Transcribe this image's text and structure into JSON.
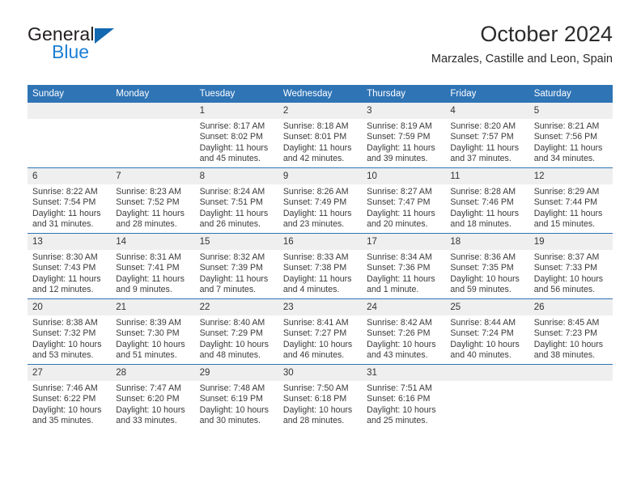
{
  "brand": {
    "name_top": "General",
    "name_bottom": "Blue",
    "triangle_color": "#1368b0",
    "blue_color": "#1d7fd4"
  },
  "header": {
    "title": "October 2024",
    "subtitle": "Marzales, Castille and Leon, Spain"
  },
  "theme": {
    "header_bg": "#2f74b5",
    "daynum_bg": "#efefef",
    "row_border": "#2f74b5",
    "text": "#3a3a3a"
  },
  "weekdays": [
    "Sunday",
    "Monday",
    "Tuesday",
    "Wednesday",
    "Thursday",
    "Friday",
    "Saturday"
  ],
  "labels": {
    "sunrise": "Sunrise:",
    "sunset": "Sunset:",
    "daylight": "Daylight:"
  },
  "weeks": [
    [
      {
        "day": "",
        "empty": true
      },
      {
        "day": "",
        "empty": true
      },
      {
        "day": "1",
        "sunrise": "Sunrise: 8:17 AM",
        "sunset": "Sunset: 8:02 PM",
        "daylight1": "Daylight: 11 hours",
        "daylight2": "and 45 minutes."
      },
      {
        "day": "2",
        "sunrise": "Sunrise: 8:18 AM",
        "sunset": "Sunset: 8:01 PM",
        "daylight1": "Daylight: 11 hours",
        "daylight2": "and 42 minutes."
      },
      {
        "day": "3",
        "sunrise": "Sunrise: 8:19 AM",
        "sunset": "Sunset: 7:59 PM",
        "daylight1": "Daylight: 11 hours",
        "daylight2": "and 39 minutes."
      },
      {
        "day": "4",
        "sunrise": "Sunrise: 8:20 AM",
        "sunset": "Sunset: 7:57 PM",
        "daylight1": "Daylight: 11 hours",
        "daylight2": "and 37 minutes."
      },
      {
        "day": "5",
        "sunrise": "Sunrise: 8:21 AM",
        "sunset": "Sunset: 7:56 PM",
        "daylight1": "Daylight: 11 hours",
        "daylight2": "and 34 minutes."
      }
    ],
    [
      {
        "day": "6",
        "sunrise": "Sunrise: 8:22 AM",
        "sunset": "Sunset: 7:54 PM",
        "daylight1": "Daylight: 11 hours",
        "daylight2": "and 31 minutes."
      },
      {
        "day": "7",
        "sunrise": "Sunrise: 8:23 AM",
        "sunset": "Sunset: 7:52 PM",
        "daylight1": "Daylight: 11 hours",
        "daylight2": "and 28 minutes."
      },
      {
        "day": "8",
        "sunrise": "Sunrise: 8:24 AM",
        "sunset": "Sunset: 7:51 PM",
        "daylight1": "Daylight: 11 hours",
        "daylight2": "and 26 minutes."
      },
      {
        "day": "9",
        "sunrise": "Sunrise: 8:26 AM",
        "sunset": "Sunset: 7:49 PM",
        "daylight1": "Daylight: 11 hours",
        "daylight2": "and 23 minutes."
      },
      {
        "day": "10",
        "sunrise": "Sunrise: 8:27 AM",
        "sunset": "Sunset: 7:47 PM",
        "daylight1": "Daylight: 11 hours",
        "daylight2": "and 20 minutes."
      },
      {
        "day": "11",
        "sunrise": "Sunrise: 8:28 AM",
        "sunset": "Sunset: 7:46 PM",
        "daylight1": "Daylight: 11 hours",
        "daylight2": "and 18 minutes."
      },
      {
        "day": "12",
        "sunrise": "Sunrise: 8:29 AM",
        "sunset": "Sunset: 7:44 PM",
        "daylight1": "Daylight: 11 hours",
        "daylight2": "and 15 minutes."
      }
    ],
    [
      {
        "day": "13",
        "sunrise": "Sunrise: 8:30 AM",
        "sunset": "Sunset: 7:43 PM",
        "daylight1": "Daylight: 11 hours",
        "daylight2": "and 12 minutes."
      },
      {
        "day": "14",
        "sunrise": "Sunrise: 8:31 AM",
        "sunset": "Sunset: 7:41 PM",
        "daylight1": "Daylight: 11 hours",
        "daylight2": "and 9 minutes."
      },
      {
        "day": "15",
        "sunrise": "Sunrise: 8:32 AM",
        "sunset": "Sunset: 7:39 PM",
        "daylight1": "Daylight: 11 hours",
        "daylight2": "and 7 minutes."
      },
      {
        "day": "16",
        "sunrise": "Sunrise: 8:33 AM",
        "sunset": "Sunset: 7:38 PM",
        "daylight1": "Daylight: 11 hours",
        "daylight2": "and 4 minutes."
      },
      {
        "day": "17",
        "sunrise": "Sunrise: 8:34 AM",
        "sunset": "Sunset: 7:36 PM",
        "daylight1": "Daylight: 11 hours",
        "daylight2": "and 1 minute."
      },
      {
        "day": "18",
        "sunrise": "Sunrise: 8:36 AM",
        "sunset": "Sunset: 7:35 PM",
        "daylight1": "Daylight: 10 hours",
        "daylight2": "and 59 minutes."
      },
      {
        "day": "19",
        "sunrise": "Sunrise: 8:37 AM",
        "sunset": "Sunset: 7:33 PM",
        "daylight1": "Daylight: 10 hours",
        "daylight2": "and 56 minutes."
      }
    ],
    [
      {
        "day": "20",
        "sunrise": "Sunrise: 8:38 AM",
        "sunset": "Sunset: 7:32 PM",
        "daylight1": "Daylight: 10 hours",
        "daylight2": "and 53 minutes."
      },
      {
        "day": "21",
        "sunrise": "Sunrise: 8:39 AM",
        "sunset": "Sunset: 7:30 PM",
        "daylight1": "Daylight: 10 hours",
        "daylight2": "and 51 minutes."
      },
      {
        "day": "22",
        "sunrise": "Sunrise: 8:40 AM",
        "sunset": "Sunset: 7:29 PM",
        "daylight1": "Daylight: 10 hours",
        "daylight2": "and 48 minutes."
      },
      {
        "day": "23",
        "sunrise": "Sunrise: 8:41 AM",
        "sunset": "Sunset: 7:27 PM",
        "daylight1": "Daylight: 10 hours",
        "daylight2": "and 46 minutes."
      },
      {
        "day": "24",
        "sunrise": "Sunrise: 8:42 AM",
        "sunset": "Sunset: 7:26 PM",
        "daylight1": "Daylight: 10 hours",
        "daylight2": "and 43 minutes."
      },
      {
        "day": "25",
        "sunrise": "Sunrise: 8:44 AM",
        "sunset": "Sunset: 7:24 PM",
        "daylight1": "Daylight: 10 hours",
        "daylight2": "and 40 minutes."
      },
      {
        "day": "26",
        "sunrise": "Sunrise: 8:45 AM",
        "sunset": "Sunset: 7:23 PM",
        "daylight1": "Daylight: 10 hours",
        "daylight2": "and 38 minutes."
      }
    ],
    [
      {
        "day": "27",
        "sunrise": "Sunrise: 7:46 AM",
        "sunset": "Sunset: 6:22 PM",
        "daylight1": "Daylight: 10 hours",
        "daylight2": "and 35 minutes."
      },
      {
        "day": "28",
        "sunrise": "Sunrise: 7:47 AM",
        "sunset": "Sunset: 6:20 PM",
        "daylight1": "Daylight: 10 hours",
        "daylight2": "and 33 minutes."
      },
      {
        "day": "29",
        "sunrise": "Sunrise: 7:48 AM",
        "sunset": "Sunset: 6:19 PM",
        "daylight1": "Daylight: 10 hours",
        "daylight2": "and 30 minutes."
      },
      {
        "day": "30",
        "sunrise": "Sunrise: 7:50 AM",
        "sunset": "Sunset: 6:18 PM",
        "daylight1": "Daylight: 10 hours",
        "daylight2": "and 28 minutes."
      },
      {
        "day": "31",
        "sunrise": "Sunrise: 7:51 AM",
        "sunset": "Sunset: 6:16 PM",
        "daylight1": "Daylight: 10 hours",
        "daylight2": "and 25 minutes."
      },
      {
        "day": "",
        "empty": true
      },
      {
        "day": "",
        "empty": true
      }
    ]
  ]
}
